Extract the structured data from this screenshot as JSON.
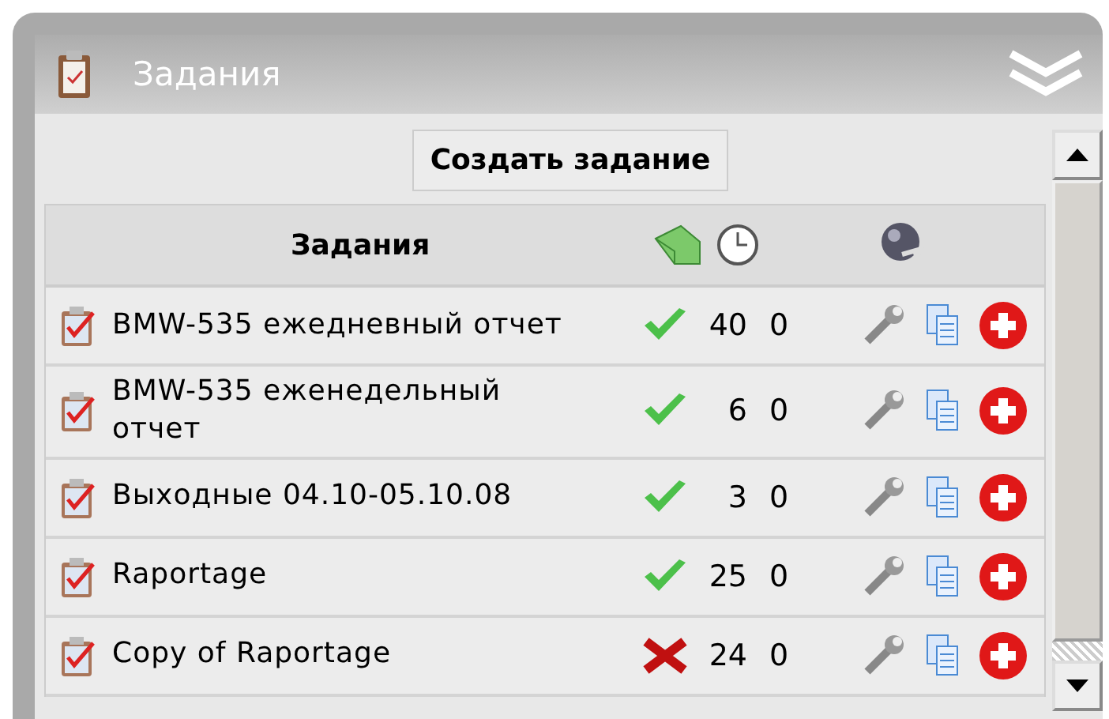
{
  "panel": {
    "title": "Задания"
  },
  "create_button": {
    "label": "Создать задание"
  },
  "table": {
    "columns": [
      {
        "label": "Задания"
      }
    ],
    "rows": [
      {
        "name": "BMW-535 ежедневный отчет",
        "active": true,
        "count": "40",
        "count_2": "0"
      },
      {
        "name": "BMW-535 еженедельный отчет",
        "active": true,
        "count": "6",
        "count_2": "0"
      },
      {
        "name": "Выходные 04.10-05.10.08",
        "active": true,
        "count": "3",
        "count_2": "0"
      },
      {
        "name": "Raportage",
        "active": true,
        "count": "25",
        "count_2": "0"
      },
      {
        "name": "Copy of Raportage",
        "active": false,
        "count": "24",
        "count_2": "0"
      }
    ]
  }
}
